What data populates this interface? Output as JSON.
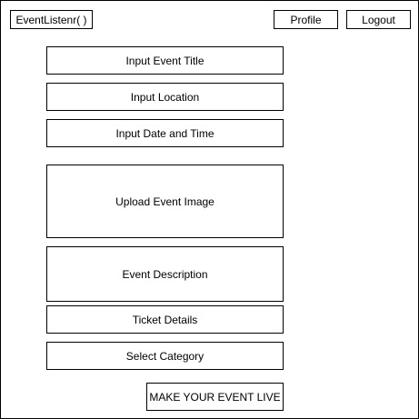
{
  "header": {
    "app_title": "EventListenr( )",
    "profile_label": "Profile",
    "logout_label": "Logout"
  },
  "form": {
    "event_title": "Input Event Title",
    "location": "Input Location",
    "date_time": "Input Date and Time",
    "event_image": "Upload Event Image",
    "description": "Event Description",
    "ticket_details": "Ticket Details",
    "category": "Select Category",
    "submit_label": "MAKE YOUR EVENT LIVE"
  }
}
